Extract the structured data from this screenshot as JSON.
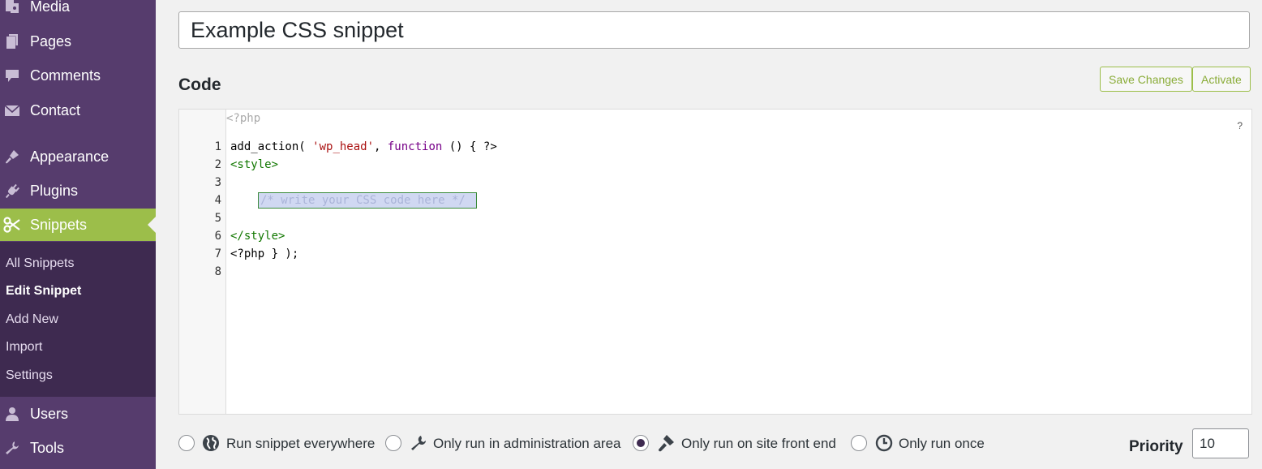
{
  "sidebar": {
    "items": [
      {
        "label": "Media",
        "icon": "media-icon"
      },
      {
        "label": "Pages",
        "icon": "pages-icon"
      },
      {
        "label": "Comments",
        "icon": "comments-icon"
      },
      {
        "label": "Contact",
        "icon": "envelope-icon"
      },
      {
        "label": "Appearance",
        "icon": "paintbrush-icon"
      },
      {
        "label": "Plugins",
        "icon": "plugin-icon"
      },
      {
        "label": "Snippets",
        "icon": "scissors-icon"
      },
      {
        "label": "Users",
        "icon": "user-icon"
      },
      {
        "label": "Tools",
        "icon": "wrench-icon"
      }
    ],
    "submenu": [
      "All Snippets",
      "Edit Snippet",
      "Add New",
      "Import",
      "Settings"
    ],
    "colors": {
      "background": "#563c6d",
      "active": "#9cbe4a",
      "submenu": "#3e2a50"
    }
  },
  "snippet": {
    "title": "Example CSS snippet",
    "code_heading": "Code",
    "save_label": "Save Changes",
    "activate_label": "Activate",
    "help_label": "?"
  },
  "editor": {
    "php_open": "<?php",
    "line_numbers": [
      "1",
      "2",
      "3",
      "4",
      "5",
      "6",
      "7",
      "8"
    ],
    "lines": {
      "l1_fn": "add_action( ",
      "l1_str": "'wp_head'",
      "l1_sep": ", ",
      "l1_kw": "function",
      "l1_rest": " () { ?>",
      "l2": "<style>",
      "l4": "/* write your CSS code here */",
      "l6": "</style>",
      "l7": "<?php } );"
    }
  },
  "scope": {
    "options": [
      {
        "label": "Run snippet everywhere",
        "icon": "globe-icon",
        "checked": false
      },
      {
        "label": "Only run in administration area",
        "icon": "wrench-icon",
        "checked": false
      },
      {
        "label": "Only run on site front end",
        "icon": "hammer-icon",
        "checked": true
      },
      {
        "label": "Only run once",
        "icon": "clock-icon",
        "checked": false
      }
    ]
  },
  "priority": {
    "label": "Priority",
    "value": "10"
  }
}
